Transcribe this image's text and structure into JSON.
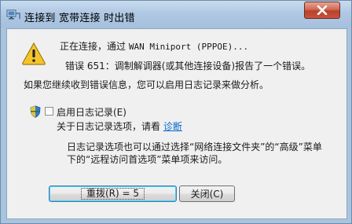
{
  "window": {
    "title": "连接到 宽带连接 时出错"
  },
  "message": {
    "connecting_prefix": "正在连接，通过 ",
    "connecting_device": "WAN Miniport (PPPOE)...",
    "error_line": "错误 651：调制解调器(或其他连接设备)报告了一个错误。",
    "advice_line": "如果您继续收到错误信息，您可以启用日志记录来做分析。"
  },
  "logging": {
    "checkbox_label": "启用日志记录(E)",
    "checked": false,
    "info_prefix": "关于日志记录选项，请看 ",
    "diagnose_link": "诊断",
    "note_line1": "日志记录选项也可以通过选择“网络连接文件夹”的“高级”菜单",
    "note_line2": "下的“远程访问首选项”菜单项来访问。"
  },
  "buttons": {
    "redial": "重拨(R) = 5",
    "close": "关闭(C)"
  }
}
